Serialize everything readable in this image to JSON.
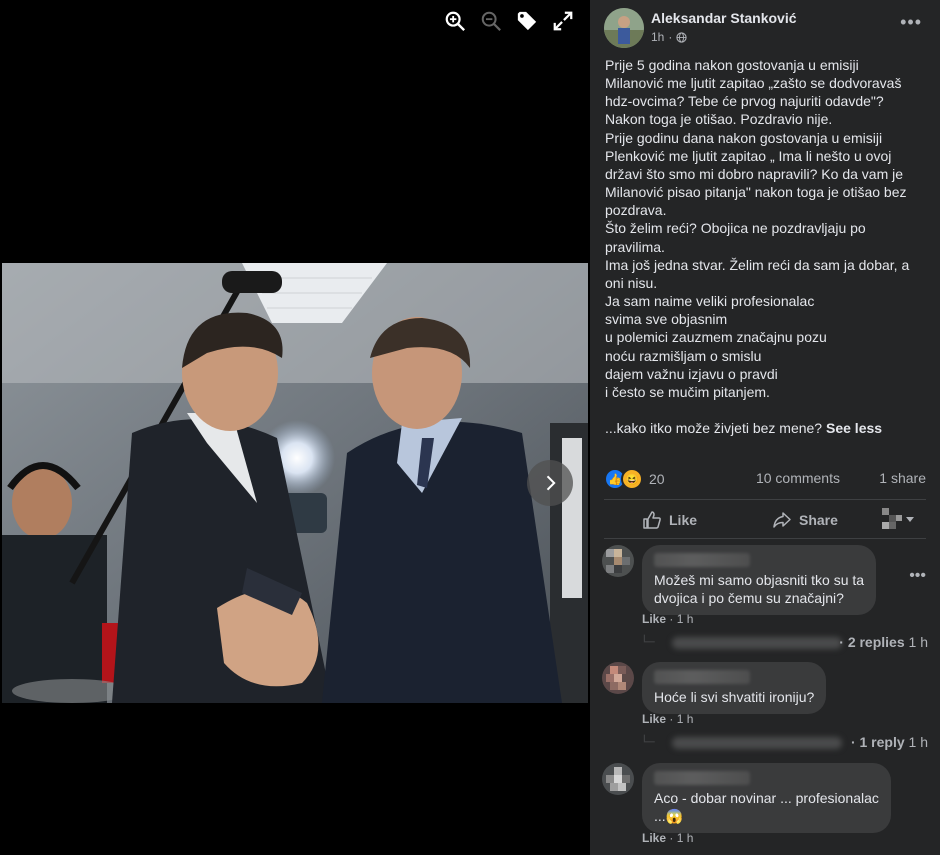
{
  "viewer": {
    "toolbar": [
      "zoom-in-icon",
      "zoom-out-icon",
      "tag-icon",
      "fullscreen-icon"
    ],
    "next_icon": "chevron-right-icon"
  },
  "post": {
    "author": "Aleksandar Stanković",
    "time": "1h",
    "privacy_icon": "globe-icon",
    "more_label": "•••",
    "lines": [
      "Prije 5 godina nakon gostovanja u emisiji",
      "Milanović me ljutit zapitao „zašto se dodvoravaš",
      "hdz-ovcima? Tebe će prvog najuriti odavde\"?",
      "Nakon toga je otišao. Pozdravio nije.",
      "Prije godinu dana nakon gostovanja u emisiji",
      "Plenković me ljutit zapitao „ Ima li nešto u ovoj",
      "državi što smo mi dobro napravili? Ko da vam je",
      "Milanović pisao pitanja\" nakon toga je otišao bez",
      "pozdrava.",
      "Što želim reći? Obojica ne pozdravljaju po",
      "pravilima.",
      "Ima još jedna stvar. Želim reći da sam ja dobar, a",
      "oni nisu.",
      "Ja sam naime veliki profesionalac",
      "svima sve objasnim",
      "u polemici zauzmem značajnu pozu",
      "noću razmišljam o smislu",
      "dajem važnu izjavu o pravdi",
      "i često se mučim pitanjem.",
      "",
      "...kako itko može živjeti bez mene?"
    ],
    "see_less": "See less",
    "reactions_count": "20",
    "comments_count": "10 comments",
    "shares_count": "1 share",
    "like_label": "Like",
    "share_label": "Share"
  },
  "comments": [
    {
      "text_lines": [
        "Možeš mi samo objasniti tko su ta",
        "dvojica i po čemu su značajni?"
      ],
      "like_label": "Like",
      "time": "1 h",
      "replies": "2 replies",
      "replies_time": "1 h"
    },
    {
      "text_lines": [
        "Hoće li svi shvatiti ironiju?"
      ],
      "like_label": "Like",
      "time": "1 h",
      "replies": "1 reply",
      "replies_time": "1 h"
    },
    {
      "text_lines": [
        "Aco - dobar novinar ... profesionalac",
        "...😱"
      ],
      "like_label": "Like",
      "time": "1 h"
    }
  ],
  "colors": {
    "panel_bg": "#242526",
    "bubble_bg": "#3a3b3c",
    "text_primary": "#e4e6eb",
    "text_secondary": "#b0b3b8",
    "like_blue": "#1877f2"
  }
}
